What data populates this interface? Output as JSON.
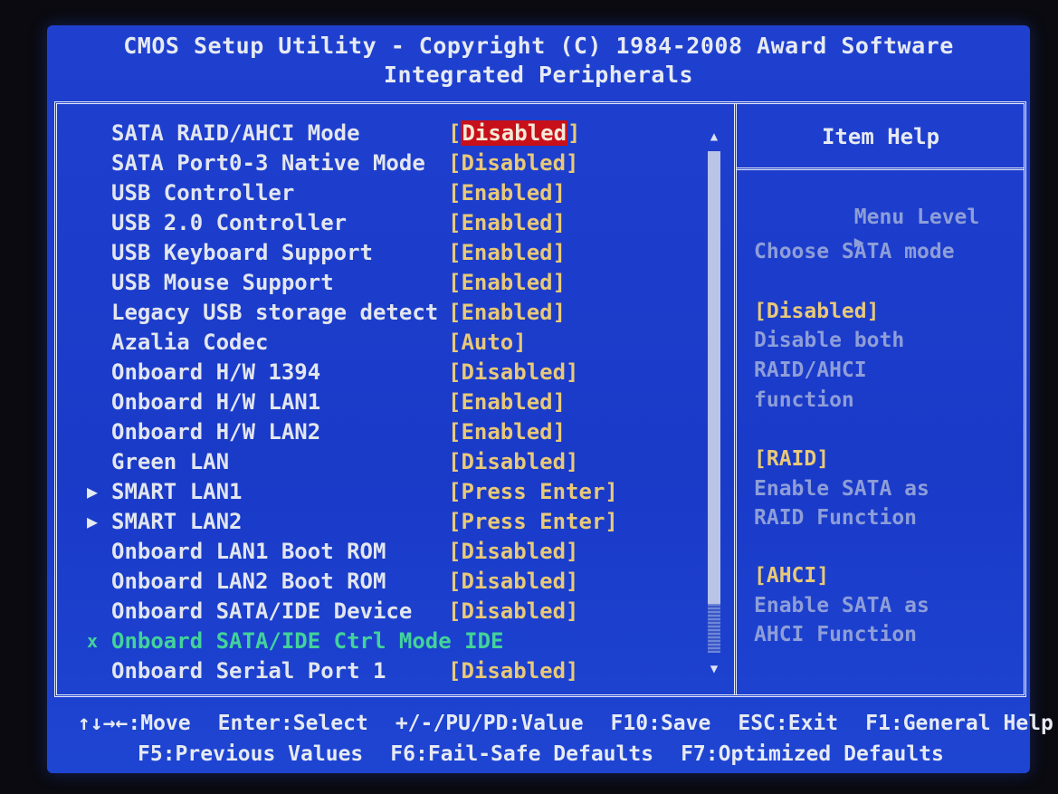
{
  "header": {
    "line1": "CMOS Setup Utility - Copyright (C) 1984-2008 Award Software",
    "line2": "Integrated Peripherals"
  },
  "items": [
    {
      "prefix": "",
      "label": "SATA RAID/AHCI Mode",
      "value_open": "[",
      "value": "Disabled",
      "value_close": "]",
      "selected": true
    },
    {
      "prefix": "",
      "label": "SATA Port0-3 Native Mode",
      "value_open": "[",
      "value": "Disabled",
      "value_close": "]"
    },
    {
      "prefix": "",
      "label": "USB Controller",
      "value_open": "[",
      "value": "Enabled",
      "value_close": "]"
    },
    {
      "prefix": "",
      "label": "USB 2.0 Controller",
      "value_open": "[",
      "value": "Enabled",
      "value_close": "]"
    },
    {
      "prefix": "",
      "label": "USB Keyboard Support",
      "value_open": "[",
      "value": "Enabled",
      "value_close": "]"
    },
    {
      "prefix": "",
      "label": "USB Mouse Support",
      "value_open": "[",
      "value": "Enabled",
      "value_close": "]"
    },
    {
      "prefix": "",
      "label": "Legacy USB storage detect",
      "value_open": "[",
      "value": "Enabled",
      "value_close": "]"
    },
    {
      "prefix": "",
      "label": "Azalia Codec",
      "value_open": "[",
      "value": "Auto",
      "value_close": "]"
    },
    {
      "prefix": "",
      "label": "Onboard H/W 1394",
      "value_open": "[",
      "value": "Disabled",
      "value_close": "]"
    },
    {
      "prefix": "",
      "label": "Onboard H/W LAN1",
      "value_open": "[",
      "value": "Enabled",
      "value_close": "]"
    },
    {
      "prefix": "",
      "label": "Onboard H/W LAN2",
      "value_open": "[",
      "value": "Enabled",
      "value_close": "]"
    },
    {
      "prefix": "",
      "label": "Green LAN",
      "value_open": "[",
      "value": "Disabled",
      "value_close": "]"
    },
    {
      "prefix": "▶",
      "label": "SMART LAN1",
      "value_open": "[",
      "value": "Press Enter",
      "value_close": "]"
    },
    {
      "prefix": "▶",
      "label": "SMART LAN2",
      "value_open": "[",
      "value": "Press Enter",
      "value_close": "]"
    },
    {
      "prefix": "",
      "label": "Onboard LAN1 Boot ROM",
      "value_open": "[",
      "value": "Disabled",
      "value_close": "]"
    },
    {
      "prefix": "",
      "label": "Onboard LAN2 Boot ROM",
      "value_open": "[",
      "value": "Disabled",
      "value_close": "]"
    },
    {
      "prefix": "",
      "label": "Onboard SATA/IDE Device",
      "value_open": "[",
      "value": "Disabled",
      "value_close": "]"
    },
    {
      "prefix": "x",
      "label": "Onboard SATA/IDE Ctrl Mode IDE",
      "value_open": "",
      "value": "",
      "value_close": "",
      "disabled": true
    },
    {
      "prefix": "",
      "label": "Onboard Serial Port 1",
      "value_open": "[",
      "value": "Disabled",
      "value_close": "]"
    }
  ],
  "scrollbar": {
    "up": "▲",
    "down": "▼"
  },
  "help": {
    "title": "Item Help",
    "menu_level": "Menu Level",
    "menu_level_arrow": "▶",
    "lines": [
      {
        "text": "Choose SATA mode",
        "kind": "text"
      },
      {
        "text": "[Disabled]",
        "kind": "opt"
      },
      {
        "text": "Disable both",
        "kind": "text"
      },
      {
        "text": "RAID/AHCI",
        "kind": "text"
      },
      {
        "text": "function",
        "kind": "text"
      },
      {
        "text": "[RAID]",
        "kind": "opt"
      },
      {
        "text": "Enable SATA as",
        "kind": "text"
      },
      {
        "text": "RAID Function",
        "kind": "text"
      },
      {
        "text": "[AHCI]",
        "kind": "opt"
      },
      {
        "text": "Enable SATA as",
        "kind": "text"
      },
      {
        "text": "AHCI Function",
        "kind": "text"
      }
    ]
  },
  "footer": {
    "line1": [
      {
        "key": "↑↓→←",
        "action": ":Move"
      },
      {
        "key": "Enter",
        "action": ":Select"
      },
      {
        "key": "+/-/PU/PD",
        "action": ":Value"
      },
      {
        "key": "F10",
        "action": ":Save"
      },
      {
        "key": "ESC",
        "action": ":Exit"
      },
      {
        "key": "F1",
        "action": ":General Help"
      }
    ],
    "line2": [
      {
        "key": "F5",
        "action": ":Previous Values"
      },
      {
        "key": "F6",
        "action": ":Fail-Safe Defaults"
      },
      {
        "key": "F7",
        "action": ":Optimized Defaults"
      }
    ]
  },
  "colors": {
    "background": "#1f40cf",
    "value": "#e8c978",
    "selected_bg": "#c8101a",
    "disabled_item": "#43d39a",
    "help_text": "#8e9ed8"
  }
}
